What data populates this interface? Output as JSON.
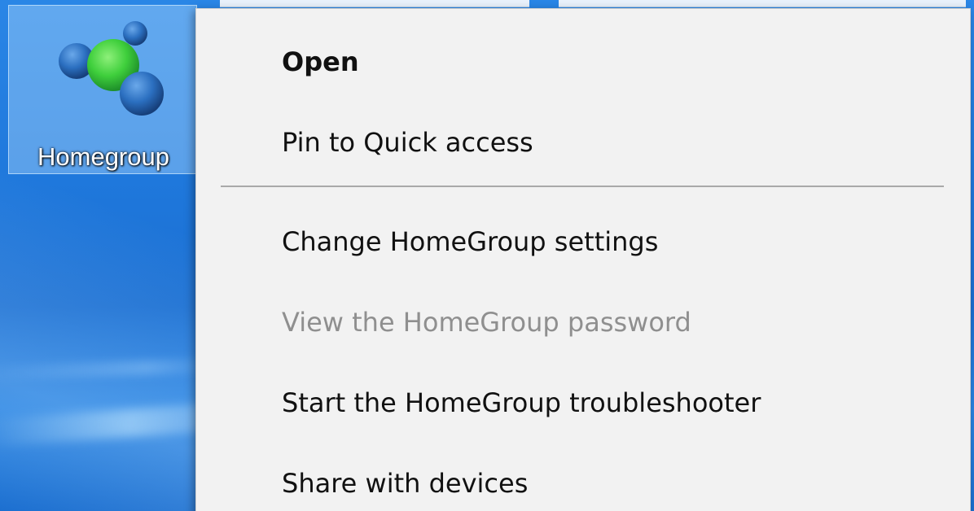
{
  "desktop": {
    "icon": {
      "label": "Homegroup",
      "icon_name": "homegroup-icon",
      "colors": {
        "green_node": "#3fcf3c",
        "blue_node": "#1f63b3"
      }
    },
    "wallpaper_color": "#1f78dc"
  },
  "context_menu": {
    "items": [
      {
        "label": "Open",
        "default": true,
        "enabled": true
      },
      {
        "label": "Pin to Quick access",
        "enabled": true
      },
      {
        "label": "Change HomeGroup settings",
        "enabled": true
      },
      {
        "label": "View the HomeGroup password",
        "enabled": false
      },
      {
        "label": "Start the HomeGroup troubleshooter",
        "enabled": true
      },
      {
        "label": "Share with devices",
        "enabled": true
      }
    ]
  }
}
